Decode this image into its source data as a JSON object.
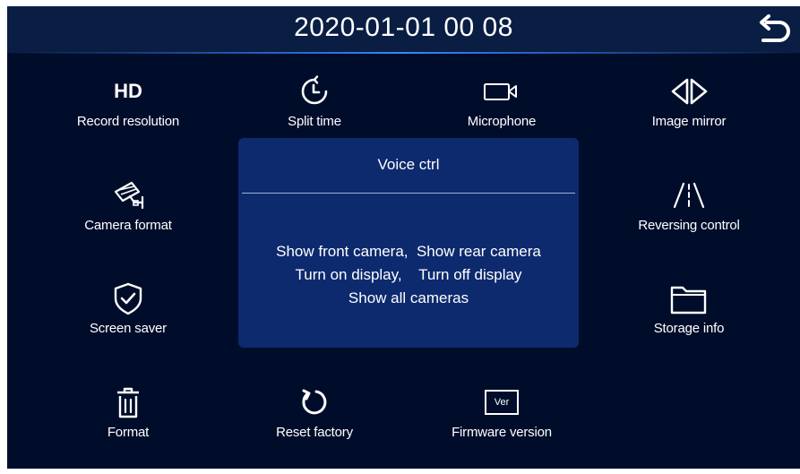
{
  "header": {
    "datetime": "2020-01-01  00 08",
    "back_icon": "back-arrow-icon"
  },
  "menu": {
    "record_resolution": {
      "icon_text": "HD",
      "label": "Record resolution"
    },
    "split_time": {
      "icon": "clock-icon",
      "label": "Split time"
    },
    "microphone": {
      "icon": "video-camera-icon",
      "label": "Microphone"
    },
    "image_mirror": {
      "icon": "mirror-arrows-icon",
      "label": "Image mirror"
    },
    "camera_format": {
      "icon": "cctv-camera-icon",
      "label": "Camera format"
    },
    "reversing_control": {
      "icon": "road-lanes-icon",
      "label": "Reversing control"
    },
    "screen_saver": {
      "icon": "shield-check-icon",
      "label": "Screen saver"
    },
    "storage_info": {
      "icon": "folder-icon",
      "label": "Storage info"
    },
    "format": {
      "icon": "trash-icon",
      "label": "Format"
    },
    "reset_factory": {
      "icon": "reset-icon",
      "label": "Reset factory"
    },
    "firmware_version": {
      "icon_text": "Ver",
      "label": "Firmware version"
    }
  },
  "dialog": {
    "title": "Voice ctrl",
    "lines": [
      "Show front camera,  Show rear camera",
      "Turn on display,    Turn off display",
      "Show all cameras"
    ]
  },
  "colors": {
    "background": "#000d2a",
    "topbar": "#0a1e44",
    "dialog": "#0d2a6e",
    "accent_line": "#3a86ff",
    "text": "#ffffff"
  }
}
